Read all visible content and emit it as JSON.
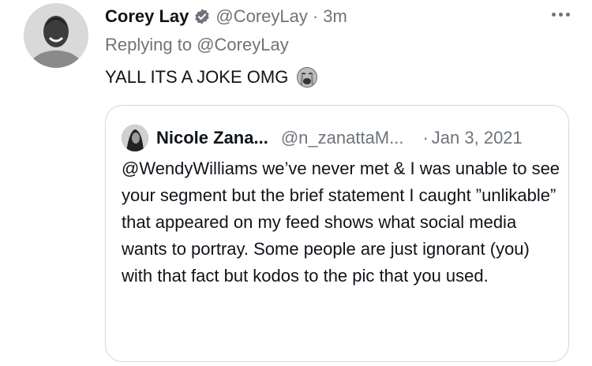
{
  "tweet": {
    "author": {
      "display_name": "Corey Lay",
      "handle": "@CoreyLay",
      "verified": true,
      "avatar_icon": "avatar-photo"
    },
    "separator": "·",
    "time": "3m",
    "replying_prefix": "Replying to",
    "replying_to": "@CoreyLay",
    "text": "YALL ITS A JOKE OMG",
    "emoji": "loudly-crying-face",
    "more_icon": "more-dots-icon"
  },
  "quoted": {
    "display_name": "Nicole Zana...",
    "handle": "@n_zanattaM...",
    "separator": "·",
    "date": "Jan 3, 2021",
    "text": "@WendyWilliams we’ve never met & I was unable to see your segment but the brief statement I caught ”unlikable” that appeared on my feed shows what social media wants to portray. Some people are just ignorant (you) with that fact but kodos to the pic that you used."
  },
  "colors": {
    "text_primary": "#0f1419",
    "text_secondary": "#6e7479",
    "border": "#cfd9de",
    "verified_badge": "#6e7479"
  }
}
